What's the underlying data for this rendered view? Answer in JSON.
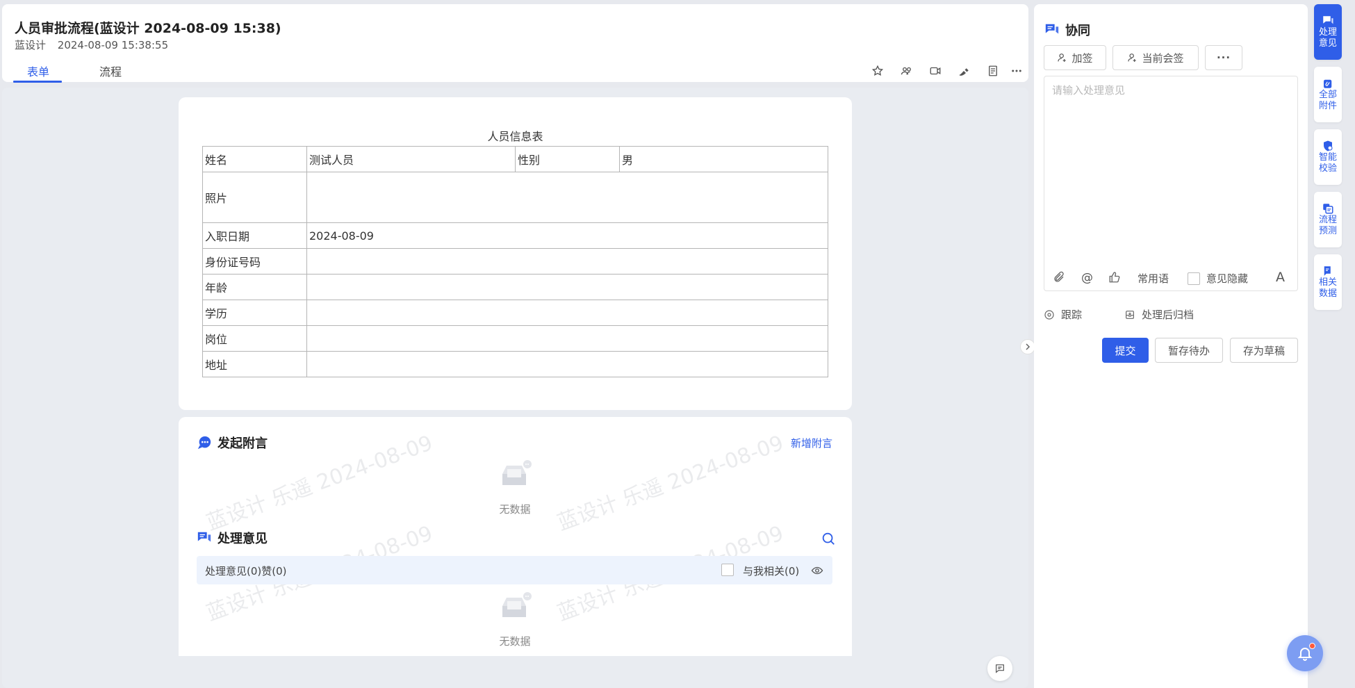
{
  "header": {
    "title": "人员审批流程(蓝设计 2024-08-09 15:38)",
    "author": "蓝设计",
    "datetime": "2024-08-09 15:38:55",
    "tabs": [
      {
        "label": "表单"
      },
      {
        "label": "流程"
      }
    ],
    "active_tab": "表单",
    "action_icons": [
      "star-icon",
      "group-icon",
      "video-icon",
      "pen-icon",
      "document-icon",
      "more-icon"
    ]
  },
  "form": {
    "title": "人员信息表",
    "fields": {
      "name_label": "姓名",
      "name_value": "测试人员",
      "gender_label": "性别",
      "gender_value": "男",
      "photo_label": "照片",
      "entry_date_label": "入职日期",
      "entry_date_value": "2024-08-09",
      "id_number_label": "身份证号码",
      "age_label": "年龄",
      "education_label": "学历",
      "position_label": "岗位",
      "address_label": "地址"
    }
  },
  "notes": {
    "title": "发起附言",
    "add_link": "新增附言",
    "empty_text": "无数据"
  },
  "opinions": {
    "title": "处理意见",
    "count_label": "处理意见(0)赞(0)",
    "related_label": "与我相关(0)",
    "empty_text": "无数据"
  },
  "watermark": {
    "text": "蓝设计  乐遥  2024-08-09"
  },
  "panel": {
    "title": "协同",
    "buttons": {
      "add_sign": "加签",
      "current_sign": "当前会签",
      "more": "···"
    },
    "placeholder": "请输入处理意见",
    "tools": {
      "common_phrases": "常用语",
      "hide_opinion": "意见隐藏",
      "font": "A"
    },
    "options": {
      "track": "跟踪",
      "archive": "处理后归档"
    },
    "actions": {
      "submit": "提交",
      "save_todo": "暂存待办",
      "save_draft": "存为草稿"
    }
  },
  "side_nav": [
    {
      "label": "处理意见",
      "icon": "chat-icon",
      "active": true
    },
    {
      "label": "全部附件",
      "icon": "attachment-icon",
      "active": false
    },
    {
      "label": "智能校验",
      "icon": "shield-icon",
      "active": false
    },
    {
      "label": "流程预测",
      "icon": "flow-icon",
      "active": false
    },
    {
      "label": "相关数据",
      "icon": "data-icon",
      "active": false
    }
  ],
  "colors": {
    "accent": "#2f5ee8",
    "background": "#e7e9ee",
    "opinion_bar": "#edf3fd"
  }
}
